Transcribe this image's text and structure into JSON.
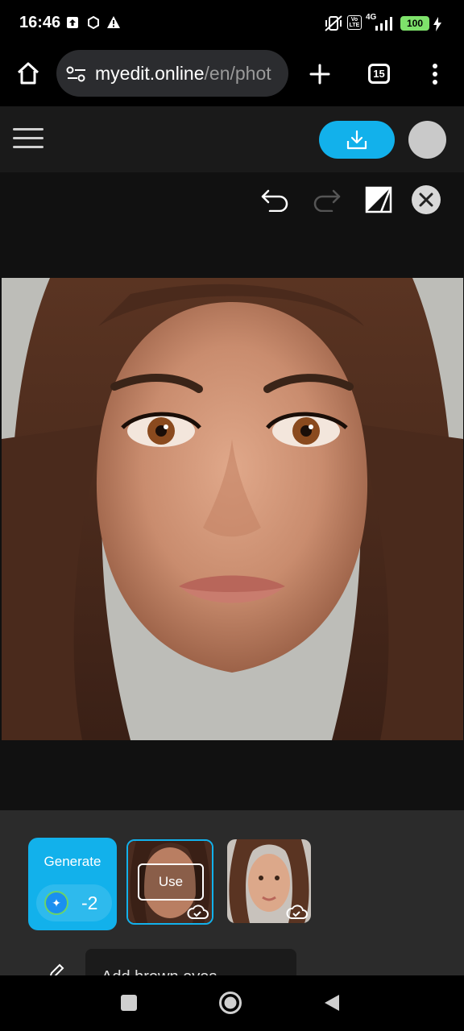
{
  "status_bar": {
    "time": "16:46",
    "network": "4G",
    "volte": "Vo LTE",
    "battery": "100"
  },
  "browser": {
    "url_host": "myedit.online",
    "url_path": "/en/phot",
    "tab_count": "15"
  },
  "generate": {
    "label": "Generate",
    "credits": "-2"
  },
  "results": {
    "use_label": "Use"
  },
  "prompt": {
    "text": "Add brown eyes"
  },
  "colors": {
    "accent": "#12b1eb",
    "panel": "#2b2b2b",
    "editor_bg": "#111111"
  }
}
